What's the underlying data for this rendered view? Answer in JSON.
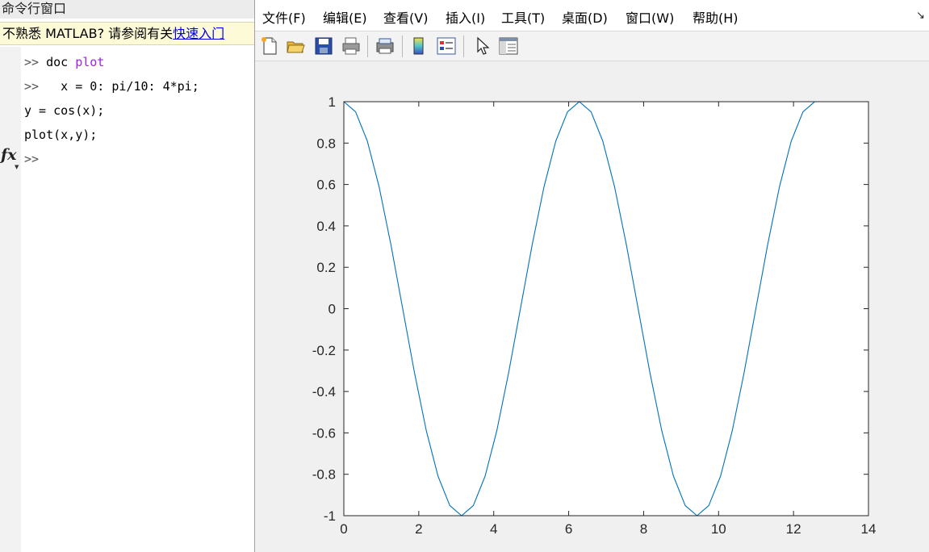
{
  "command_window": {
    "title": "命令行窗口",
    "banner_text": "不熟悉 MATLAB? 请参阅有关",
    "banner_link": "快速入门",
    "lines": [
      {
        "prompt": ">> ",
        "code": "doc ",
        "keyword": "plot"
      },
      {
        "prompt": ">>  ",
        "code": " x = 0: pi/10: 4*pi;",
        "keyword": ""
      },
      {
        "prompt": "",
        "code": "y = cos(x);",
        "keyword": ""
      },
      {
        "prompt": "",
        "code": "plot(x,y);",
        "keyword": ""
      }
    ],
    "current_prompt": ">>",
    "fx_label": "fx"
  },
  "figure_window": {
    "menu": [
      "文件(F)",
      "编辑(E)",
      "查看(V)",
      "插入(I)",
      "工具(T)",
      "桌面(D)",
      "窗口(W)",
      "帮助(H)"
    ],
    "toolbar_icons": [
      "new-figure-icon",
      "open-file-icon",
      "save-icon",
      "print-icon",
      "print-preview-icon",
      "colorbar-icon",
      "legend-icon",
      "pointer-icon",
      "property-inspector-icon"
    ],
    "line_color": "#0072bd"
  },
  "chart_data": {
    "type": "line",
    "title": "",
    "xlabel": "",
    "ylabel": "",
    "xlim": [
      0,
      14
    ],
    "ylim": [
      -1,
      1
    ],
    "xticks": [
      "0",
      "2",
      "4",
      "6",
      "8",
      "10",
      "12",
      "14"
    ],
    "yticks": [
      "-1",
      "-0.8",
      "-0.6",
      "-0.4",
      "-0.2",
      "0",
      "0.2",
      "0.4",
      "0.6",
      "0.8",
      "1"
    ],
    "grid": false,
    "series": [
      {
        "x": [
          0,
          0.3142,
          0.6283,
          0.9425,
          1.2566,
          1.5708,
          1.885,
          2.1991,
          2.5133,
          2.8274,
          3.1416,
          3.4558,
          3.7699,
          4.0841,
          4.3982,
          4.7124,
          5.0265,
          5.3407,
          5.6549,
          5.969,
          6.2832,
          6.5973,
          6.9115,
          7.2257,
          7.5398,
          7.854,
          8.1681,
          8.4823,
          8.7965,
          9.1106,
          9.4248,
          9.7389,
          10.0531,
          10.3673,
          10.6814,
          10.9956,
          11.3097,
          11.6239,
          11.9381,
          12.2522,
          12.5664
        ],
        "y": [
          1,
          0.951,
          0.809,
          0.588,
          0.309,
          0,
          -0.309,
          -0.588,
          -0.809,
          -0.951,
          -1,
          -0.951,
          -0.809,
          -0.588,
          -0.309,
          0,
          0.309,
          0.588,
          0.809,
          0.951,
          1,
          0.951,
          0.809,
          0.588,
          0.309,
          0,
          -0.309,
          -0.588,
          -0.809,
          -0.951,
          -1,
          -0.951,
          -0.809,
          -0.588,
          -0.309,
          0,
          0.309,
          0.588,
          0.809,
          0.951,
          1
        ]
      }
    ]
  }
}
